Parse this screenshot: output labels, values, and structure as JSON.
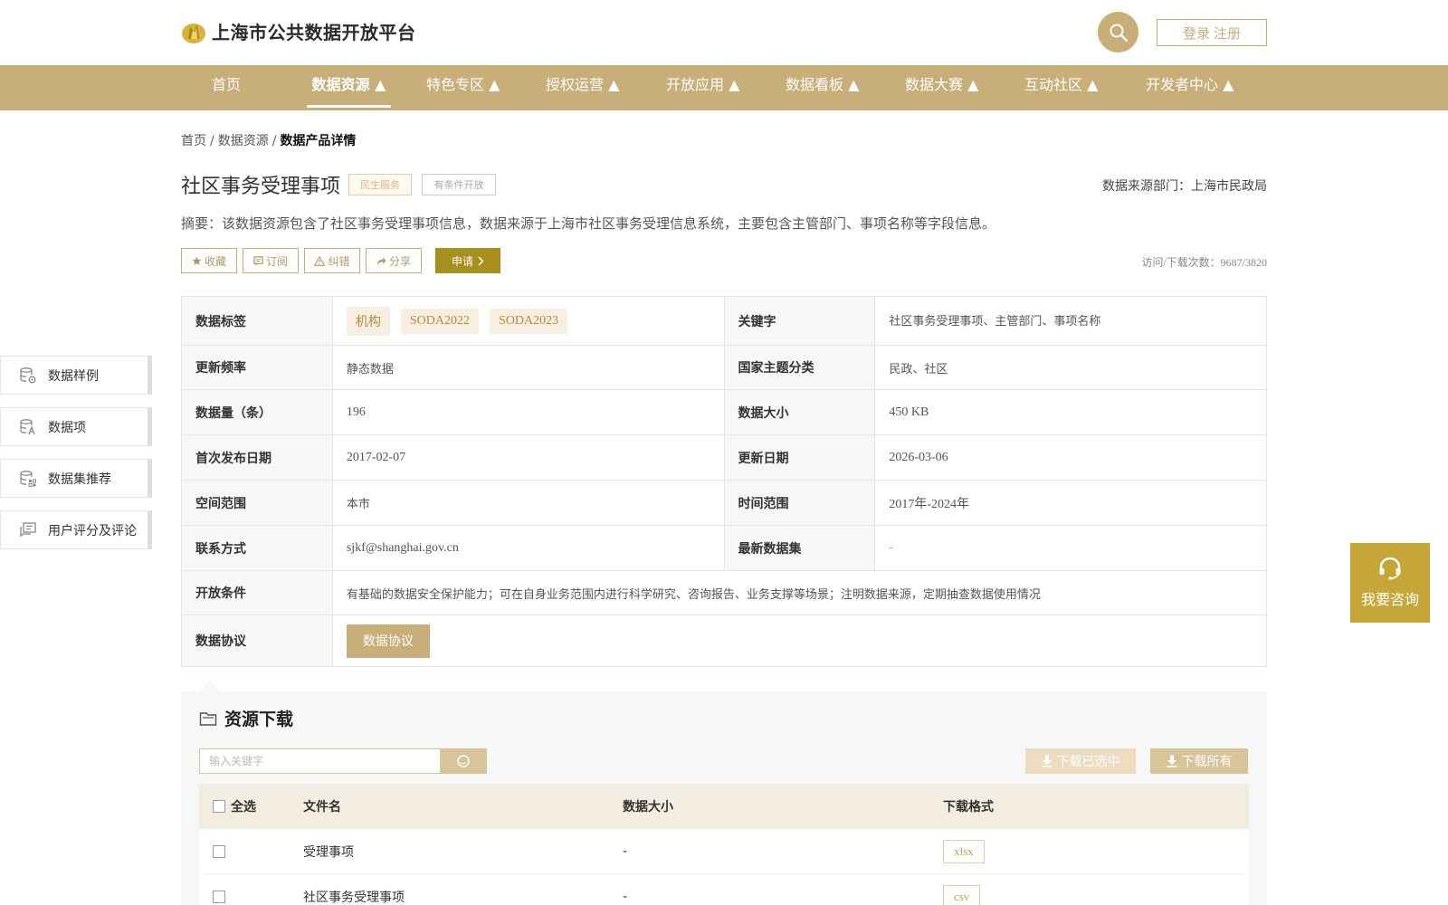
{
  "header": {
    "site_title": "上海市公共数据开放平台",
    "login_label": "登录",
    "register_label": "注册"
  },
  "nav": [
    {
      "label": "首页"
    },
    {
      "label": "数据资源 ▲"
    },
    {
      "label": "特色专区 ▲"
    },
    {
      "label": "授权运营 ▲"
    },
    {
      "label": "开放应用 ▲"
    },
    {
      "label": "数据看板 ▲"
    },
    {
      "label": "数据大赛 ▲"
    },
    {
      "label": "互动社区 ▲"
    },
    {
      "label": "开发者中心 ▲"
    }
  ],
  "breadcrumb": {
    "home": "首页",
    "section": "数据资源",
    "current": "数据产品详情",
    "sep": "/"
  },
  "dataset": {
    "title": "社区事务受理事项",
    "tag_category": "民生服务",
    "tag_open": "有条件开放",
    "source": "数据来源部门：上海市民政局",
    "summary": "摘要：该数据资源包含了社区事务受理事项信息，数据来源于上海市社区事务受理信息系统，主要包含主管部门、事项名称等字段信息。",
    "visits": "访问/下载次数：9687/3820"
  },
  "actions": {
    "favorite": "收藏",
    "subscribe": "订阅",
    "correct": "纠错",
    "share": "分享",
    "apply": "申请"
  },
  "info": {
    "tags_label": "数据标签",
    "tags": [
      "机构",
      "SODA2022",
      "SODA2023"
    ],
    "keywords_label": "关键字",
    "keywords": "社区事务受理事项、主管部门、事项名称",
    "freq_label": "更新频率",
    "freq": "静态数据",
    "topic_label": "国家主题分类",
    "topic": "民政、社区",
    "count_label": "数据量（条）",
    "count": "196",
    "size_label": "数据大小",
    "size": "450 KB",
    "first_label": "首次发布日期",
    "first": "2017-02-07",
    "update_label": "更新日期",
    "update": "2026-03-06",
    "space_label": "空间范围",
    "space": "本市",
    "time_label": "时间范围",
    "time": "2017年-2024年",
    "contact_label": "联系方式",
    "contact": "sjkf@shanghai.gov.cn",
    "latest_label": "最新数据集",
    "latest": "-",
    "cond_label": "开放条件",
    "cond": "有基础的数据安全保护能力；可在自身业务范围内进行科学研究、咨询报告、业务支撑等场景；注明数据来源，定期抽查数据使用情况",
    "agreement_label": "数据协议",
    "agreement_button": "数据协议"
  },
  "side_menu": [
    {
      "label": "数据样例"
    },
    {
      "label": "数据项"
    },
    {
      "label": "数据集推荐"
    },
    {
      "label": "用户评分及评论"
    }
  ],
  "consult": "我要咨询",
  "resources": {
    "title": "资源下载",
    "search_placeholder": "输入关键字",
    "download_selected": "下载已选中",
    "download_all": "下载所有",
    "columns": {
      "select_all": "全选",
      "filename": "文件名",
      "size": "数据大小",
      "format": "下载格式"
    },
    "files": [
      {
        "name": "受理事项",
        "size": "-",
        "format": "xlsx"
      },
      {
        "name": "社区事务受理事项",
        "size": "-",
        "format": "csv"
      }
    ]
  },
  "colors": {
    "brand": "#c8ae78",
    "apply": "#a8901e",
    "consult": "#c5a637"
  }
}
